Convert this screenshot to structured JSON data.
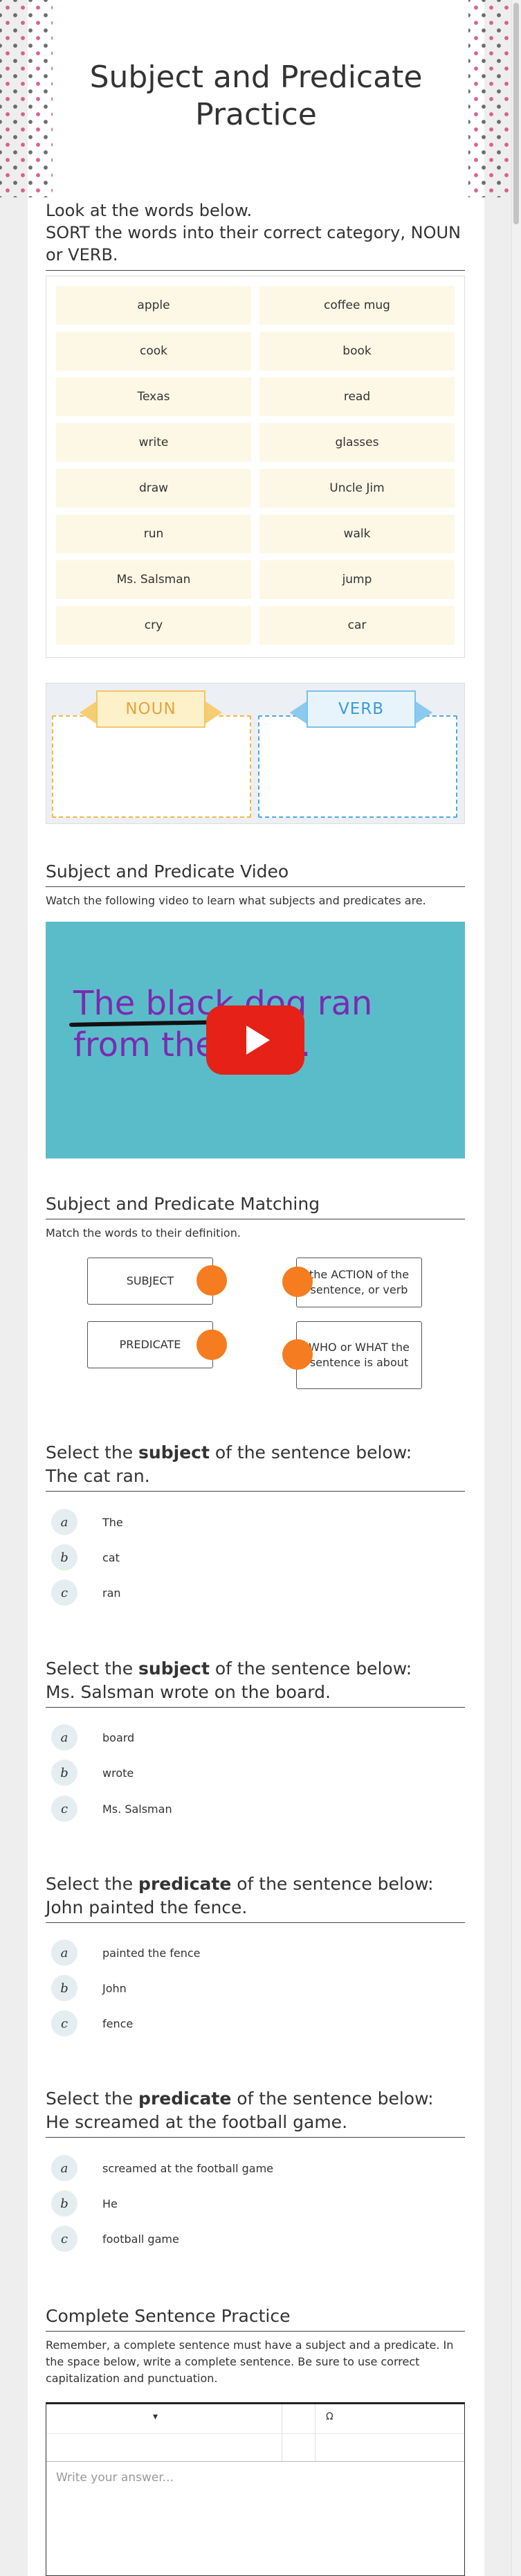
{
  "title": "Subject and Predicate Practice",
  "sort": {
    "line1": "Look at the words below.",
    "line2": "SORT the words into their correct category, NOUN or VERB.",
    "words_left": [
      "apple",
      "cook",
      "Texas",
      "write",
      "draw",
      "run",
      "Ms. Salsman",
      "cry"
    ],
    "words_right": [
      "coffee mug",
      "book",
      "read",
      "glasses",
      "Uncle Jim",
      "walk",
      "jump",
      "car"
    ],
    "bucket_noun": "NOUN",
    "bucket_verb": "VERB",
    "noun_color": "#f3b744",
    "verb_color": "#4da8e0"
  },
  "video": {
    "heading": "Subject and Predicate Video",
    "instructions": "Watch the following video to learn what subjects and predicates are.",
    "caption": "The black dog ran from the yard."
  },
  "matching": {
    "heading": "Subject and Predicate Matching",
    "instructions": "Match the words to their definition.",
    "left": [
      "SUBJECT",
      "PREDICATE"
    ],
    "right": [
      "the ACTION of the sentence, or verb",
      "WHO or WHAT the sentence is about"
    ],
    "dot_color": "#f57c1f"
  },
  "questions": [
    {
      "prefix": "Select the ",
      "keyword": "subject",
      "suffix": " of the sentence below:",
      "sentence": "The cat ran.",
      "choices": [
        "The",
        "cat",
        "ran"
      ]
    },
    {
      "prefix": "Select the ",
      "keyword": "subject",
      "suffix": " of the sentence below:",
      "sentence": "Ms. Salsman wrote on the board.",
      "choices": [
        "board",
        "wrote",
        "Ms. Salsman"
      ]
    },
    {
      "prefix": "Select the ",
      "keyword": "predicate",
      "suffix": " of the sentence below:",
      "sentence": "John painted the fence.",
      "choices": [
        "painted the fence",
        "John",
        "fence"
      ]
    },
    {
      "prefix": "Select the ",
      "keyword": "predicate",
      "suffix": " of the sentence below:",
      "sentence": "He screamed at the football game.",
      "choices": [
        "screamed at the football game",
        "He",
        "football game"
      ]
    }
  ],
  "choice_letters": [
    "a",
    "b",
    "c"
  ],
  "complete": {
    "heading": "Complete Sentence Practice",
    "instructions": "Remember, a complete sentence must have a subject and a predicate. In the space below, write a complete sentence. Be sure to use correct capitalization and punctuation.",
    "toolbar_dropdown": "▾",
    "toolbar_omega": "Ω",
    "placeholder": "Write your answer..."
  }
}
